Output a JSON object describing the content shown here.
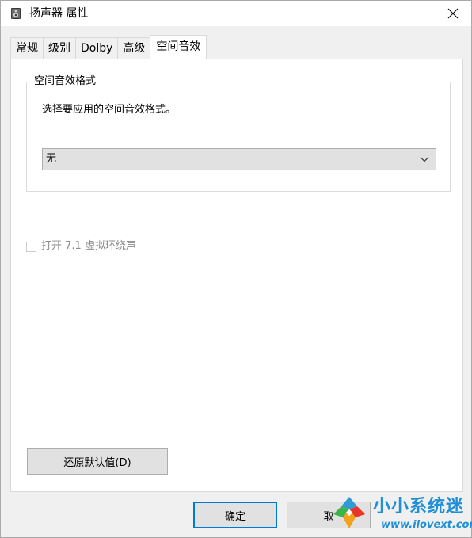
{
  "window": {
    "title": "扬声器 属性",
    "icon": "speaker-icon",
    "close_icon": "close-icon"
  },
  "tabs": [
    {
      "label": "常规",
      "active": false
    },
    {
      "label": "级别",
      "active": false
    },
    {
      "label": "Dolby",
      "active": false
    },
    {
      "label": "高级",
      "active": false
    },
    {
      "label": "空间音效",
      "active": true
    }
  ],
  "spatial_group": {
    "legend": "空间音效格式",
    "description": "选择要应用的空间音效格式。",
    "select_value": "无"
  },
  "virtual_surround": {
    "label": "打开 7.1 虚拟环绕声",
    "checked": false,
    "disabled": true
  },
  "buttons": {
    "restore": "还原默认值(D)",
    "ok": "确定",
    "cancel": "取"
  },
  "watermark": {
    "brand": "小小系统迷",
    "url": "www.ilovext.com"
  },
  "colors": {
    "accent": "#0078d7",
    "watermark": "#1f8fd6"
  }
}
